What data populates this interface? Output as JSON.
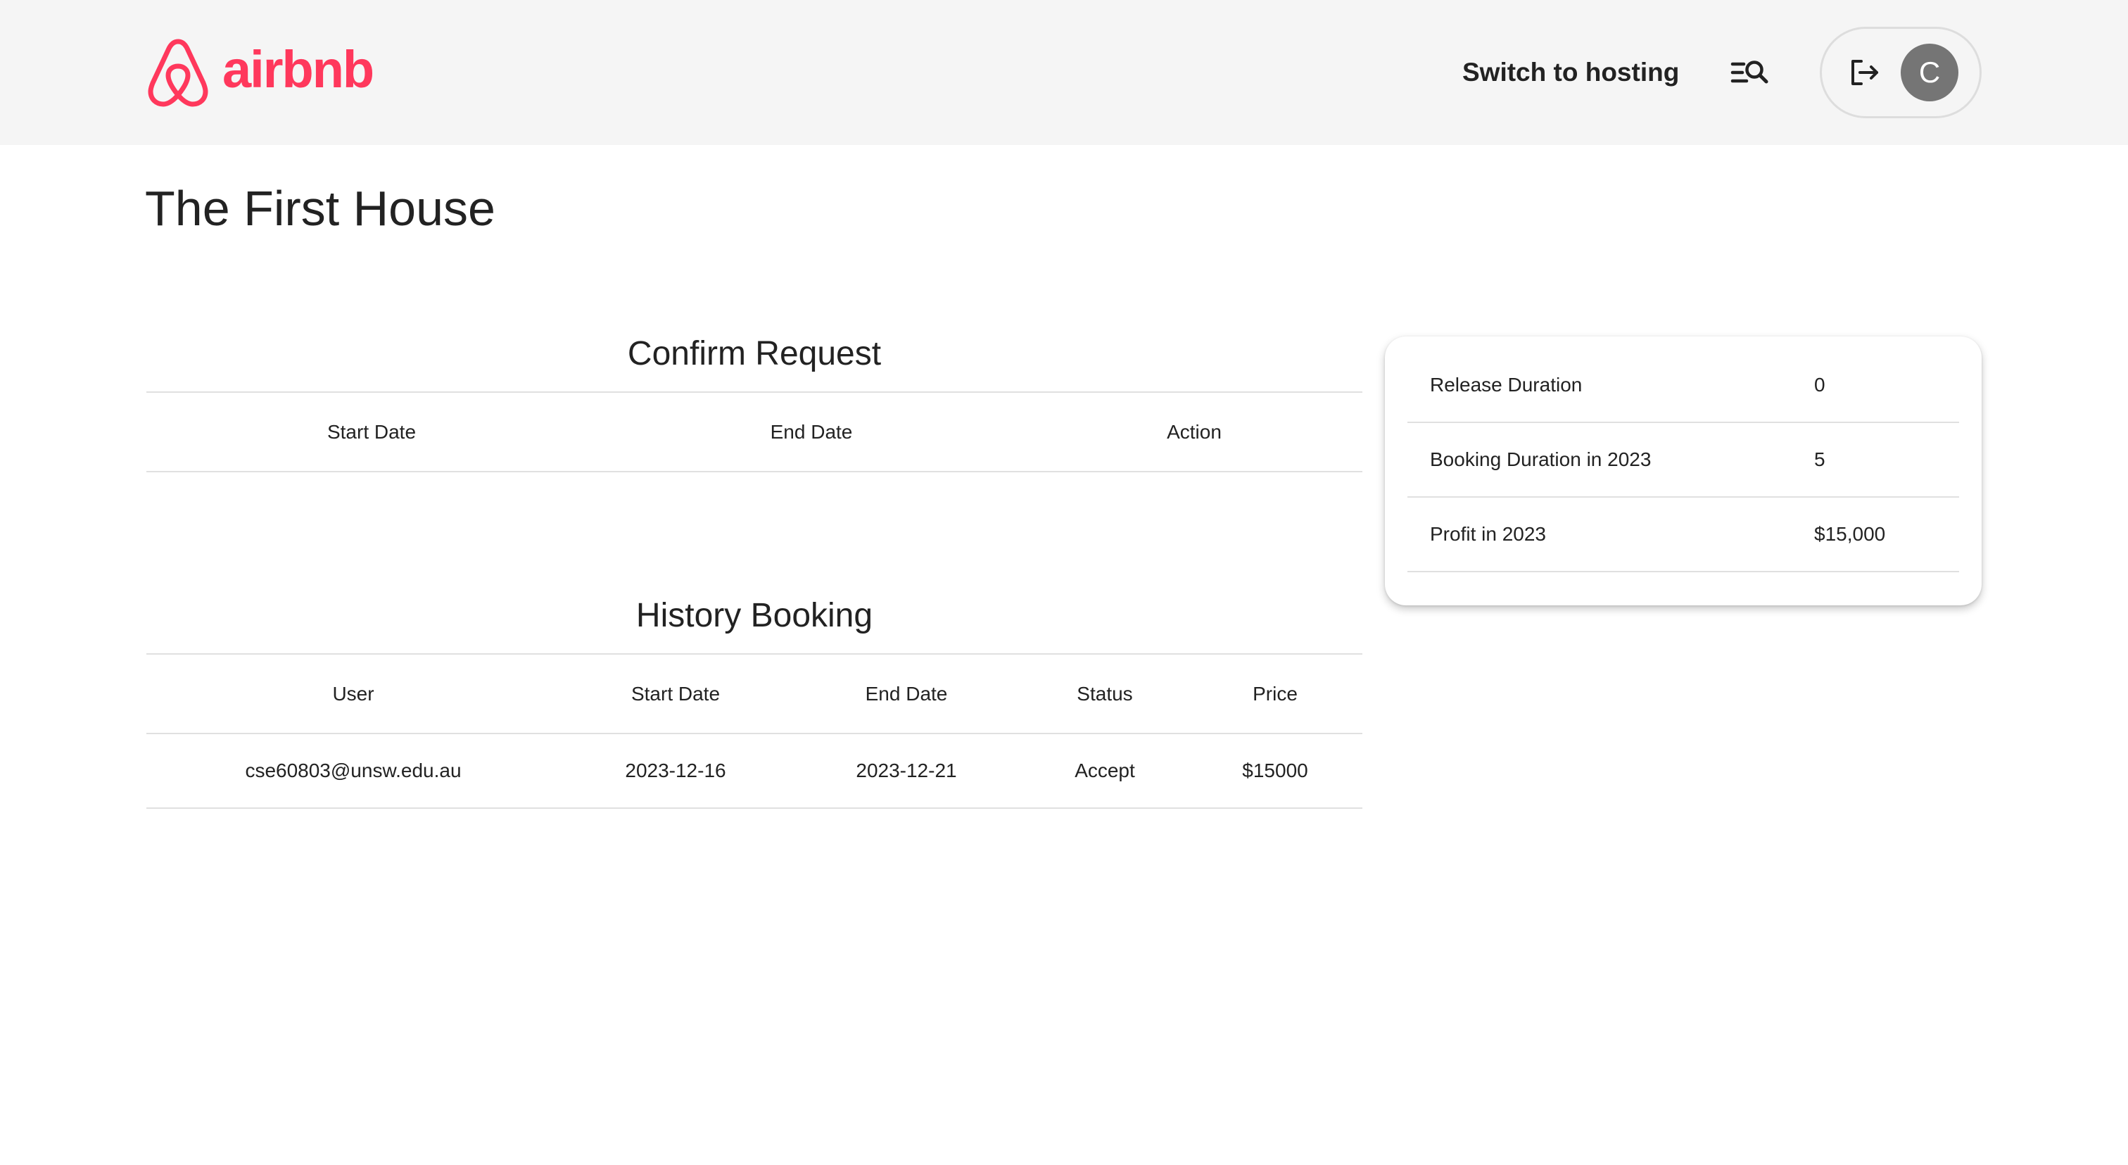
{
  "header": {
    "logo_text": "airbnb",
    "brand_color": "#ff385c",
    "switch_hosting_label": "Switch to hosting",
    "search_icon": "search-list-icon",
    "logout_icon": "logout-icon",
    "avatar_initial": "C"
  },
  "page": {
    "title": "The First House"
  },
  "confirm_request": {
    "title": "Confirm Request",
    "columns": [
      "Start Date",
      "End Date",
      "Action"
    ]
  },
  "history_booking": {
    "title": "History Booking",
    "columns": [
      "User",
      "Start Date",
      "End Date",
      "Status",
      "Price"
    ],
    "rows": [
      {
        "user": "cse60803@unsw.edu.au",
        "start_date": "2023-12-16",
        "end_date": "2023-12-21",
        "status": "Accept",
        "price": "$15000"
      }
    ]
  },
  "stats": {
    "rows": [
      {
        "label": "Release Duration",
        "value": "0"
      },
      {
        "label": "Booking Duration in 2023",
        "value": "5"
      },
      {
        "label": "Profit in 2023",
        "value": "$15,000"
      }
    ]
  }
}
